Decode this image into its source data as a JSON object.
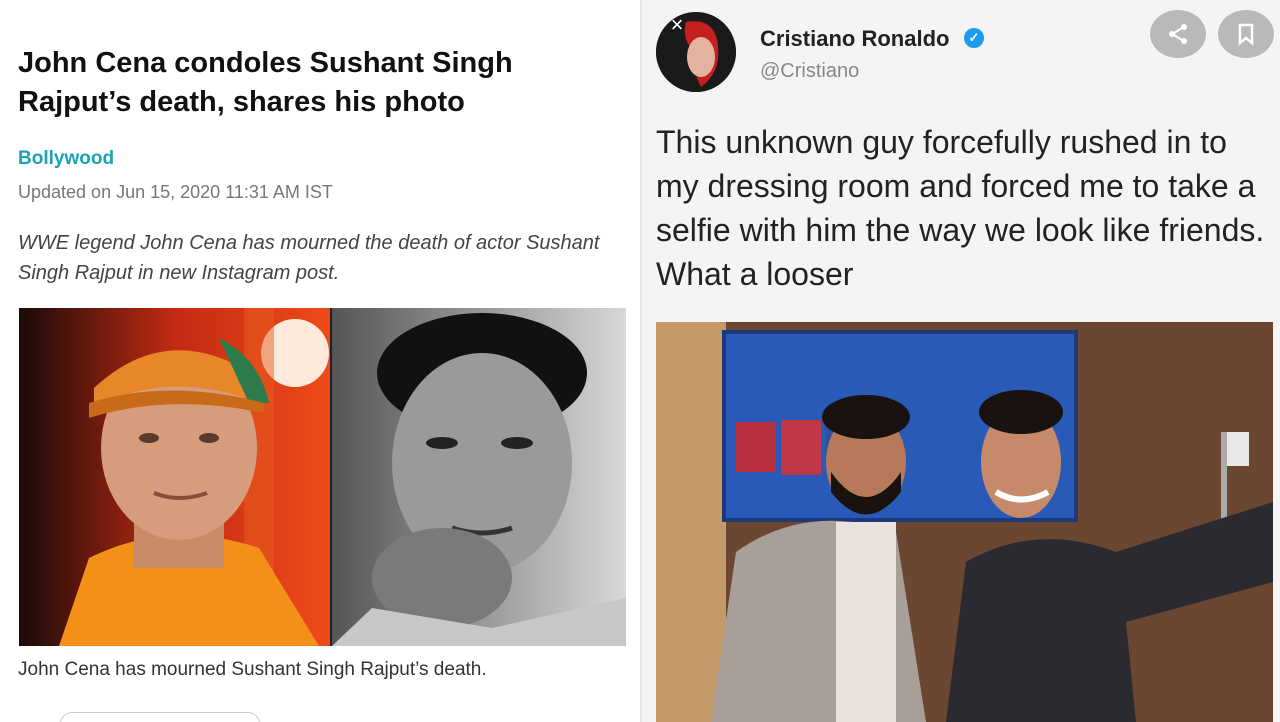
{
  "article": {
    "headline": "John Cena condoles Sushant Singh Rajput’s death, shares his photo",
    "category": "Bollywood",
    "updated": "Updated on Jun 15, 2020 11:31 AM IST",
    "summary": "WWE legend John Cena has mourned the death of actor Sushant Singh Rajput in new Instagram post.",
    "caption": "John Cena has mourned Sushant Singh Rajput’s death."
  },
  "tweet": {
    "display_name": "Cristiano Ronaldo",
    "handle": "@Cristiano",
    "text": "This unknown guy forcefully rushed in to my dressing room and forced me to take a selfie with him the way we look like friends. What a looser",
    "verified": "✓"
  },
  "icons": {
    "share": "share-icon",
    "bookmark": "bookmark-icon",
    "verified": "verified-badge-icon",
    "close": "close-icon"
  },
  "colors": {
    "category": "#1aa3b5",
    "verified": "#1d9bf0",
    "action_button": "#b9b9b9"
  }
}
